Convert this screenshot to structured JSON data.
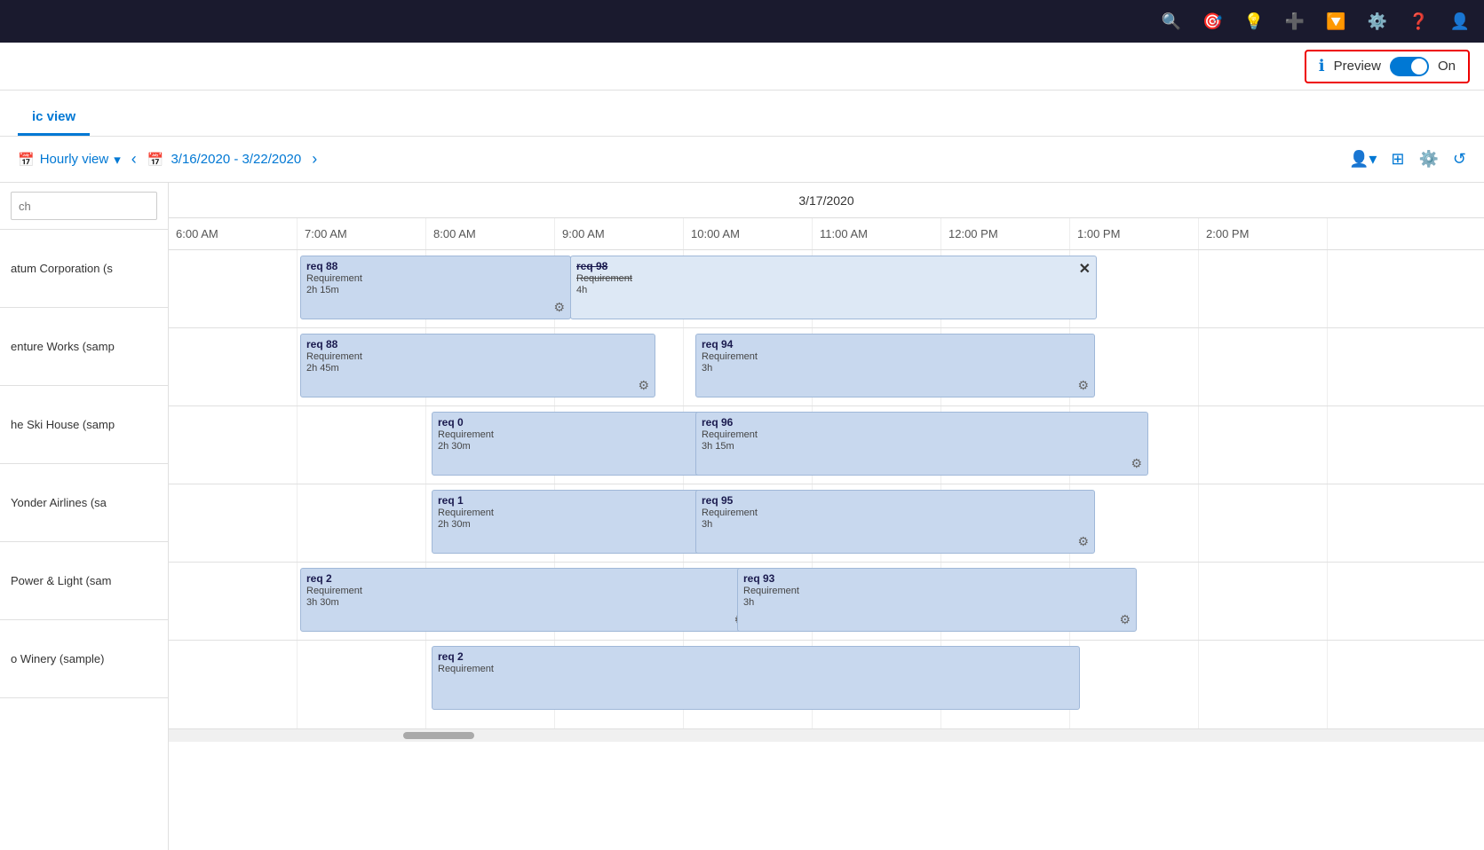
{
  "topNav": {
    "icons": [
      "search",
      "target",
      "lightbulb",
      "plus",
      "filter",
      "gear",
      "question",
      "user"
    ]
  },
  "previewBar": {
    "infoLabel": "ℹ",
    "label": "Preview",
    "toggleState": "on",
    "onLabel": "On"
  },
  "tabs": [
    {
      "id": "board",
      "label": "ic view",
      "active": true
    }
  ],
  "toolbar": {
    "hourlyViewLabel": "Hourly view",
    "dateRange": "3/16/2020 - 3/22/2020",
    "calendarIcon": "📅"
  },
  "dateHeader": "3/17/2020",
  "timeHeaders": [
    "6:00 AM",
    "7:00 AM",
    "8:00 AM",
    "9:00 AM",
    "10:00 AM",
    "11:00 AM",
    "12:00 PM",
    "1:00 PM",
    "2:00 PM"
  ],
  "resources": [
    {
      "name": "atum Corporation (s"
    },
    {
      "name": "enture Works (samp"
    },
    {
      "name": "he Ski House (samp"
    },
    {
      "name": "Yonder Airlines (sa"
    },
    {
      "name": "Power & Light (sam"
    },
    {
      "name": "o Winery (sample)"
    }
  ],
  "events": [
    {
      "row": 0,
      "title": "req 88",
      "type": "Requirement",
      "duration": "2h 15m",
      "startCol": 1,
      "widthCols": 2.1,
      "strikethrough": false,
      "hasIcon": true,
      "hasClose": false
    },
    {
      "row": 0,
      "title": "req 98",
      "type": "Requirement",
      "duration": "4h",
      "startCol": 3,
      "widthCols": 4.1,
      "strikethrough": true,
      "hasIcon": false,
      "hasClose": true
    },
    {
      "row": 1,
      "title": "req 88",
      "type": "Requirement",
      "duration": "2h 45m",
      "startCol": 1,
      "widthCols": 2.8,
      "strikethrough": false,
      "hasIcon": true,
      "hasClose": false
    },
    {
      "row": 1,
      "title": "req 94",
      "type": "Requirement",
      "duration": "3h",
      "startCol": 3,
      "widthCols": 3.1,
      "strikethrough": false,
      "hasIcon": true,
      "hasClose": false
    },
    {
      "row": 2,
      "title": "req 0",
      "type": "Requirement",
      "duration": "2h 30m",
      "startCol": 2,
      "widthCols": 2.4,
      "strikethrough": false,
      "hasIcon": true,
      "hasClose": false
    },
    {
      "row": 2,
      "title": "req 96",
      "type": "Requirement",
      "duration": "3h 15m",
      "startCol": 3,
      "widthCols": 3.8,
      "strikethrough": false,
      "hasIcon": true,
      "hasClose": false
    },
    {
      "row": 3,
      "title": "req 1",
      "type": "Requirement",
      "duration": "2h 30m",
      "startCol": 2,
      "widthCols": 2.4,
      "strikethrough": false,
      "hasIcon": true,
      "hasClose": false
    },
    {
      "row": 3,
      "title": "req 95",
      "type": "Requirement",
      "duration": "3h",
      "startCol": 3,
      "widthCols": 3.1,
      "strikethrough": false,
      "hasIcon": true,
      "hasClose": false
    },
    {
      "row": 4,
      "title": "req 2",
      "type": "Requirement",
      "duration": "3h 30m",
      "startCol": 1,
      "widthCols": 3.5,
      "strikethrough": false,
      "hasIcon": true,
      "hasClose": false
    },
    {
      "row": 4,
      "title": "req 93",
      "type": "Requirement",
      "duration": "3h",
      "startCol": 3,
      "widthCols": 3.1,
      "strikethrough": false,
      "hasIcon": true,
      "hasClose": false
    },
    {
      "row": 5,
      "title": "req 2",
      "type": "Requirement",
      "duration": "",
      "startCol": 2,
      "widthCols": 5,
      "strikethrough": false,
      "hasIcon": false,
      "hasClose": false
    }
  ],
  "search": {
    "placeholder": "ch"
  }
}
